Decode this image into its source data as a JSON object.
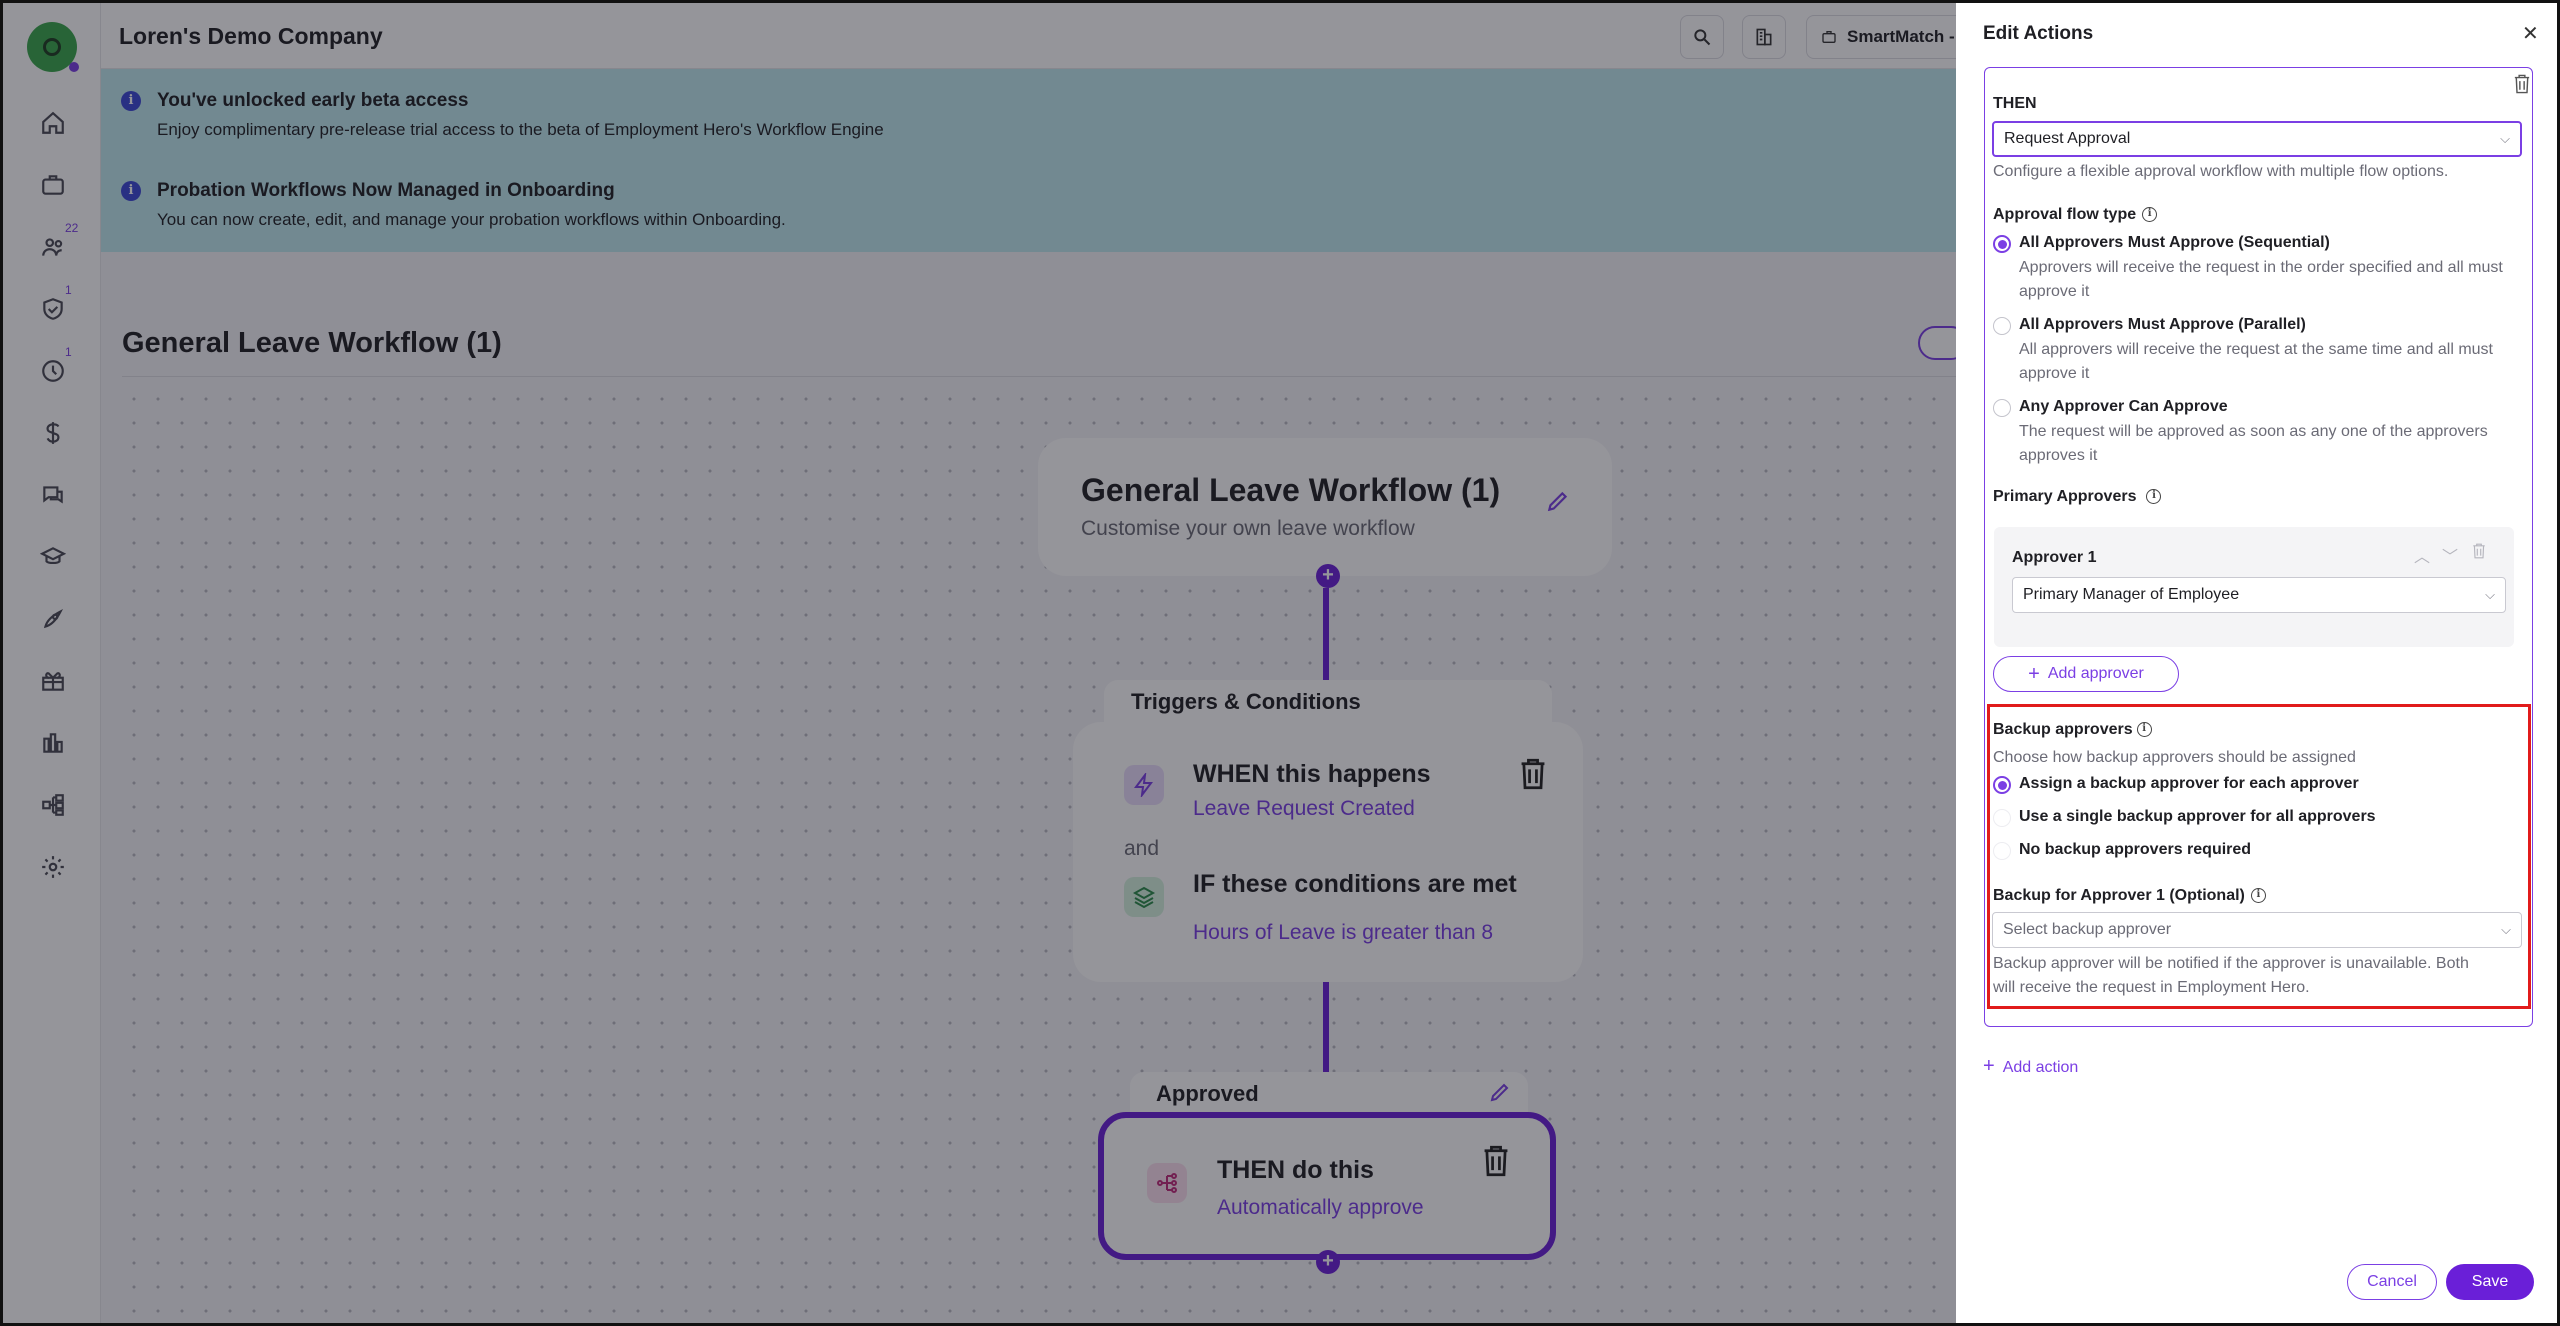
{
  "topbar": {
    "company_name": "Loren's Demo Company",
    "smartmatch_label": "SmartMatch -"
  },
  "sidebar": {
    "items": [
      {
        "icon": "home-icon"
      },
      {
        "icon": "briefcase-icon"
      },
      {
        "icon": "people-icon",
        "badge": "22"
      },
      {
        "icon": "shield-check-icon",
        "badge": "1"
      },
      {
        "icon": "clock-icon",
        "badge": "1"
      },
      {
        "icon": "dollar-icon"
      },
      {
        "icon": "chat-icon"
      },
      {
        "icon": "graduation-icon"
      },
      {
        "icon": "rocket-icon"
      },
      {
        "icon": "gift-icon"
      },
      {
        "icon": "chart-icon"
      },
      {
        "icon": "workflow-icon"
      },
      {
        "icon": "gear-icon"
      }
    ]
  },
  "banners": [
    {
      "title": "You've unlocked early beta access",
      "text": "Enjoy complimentary pre-release trial access to the beta of Employment Hero's Workflow Engine"
    },
    {
      "title": "Probation Workflows Now Managed in Onboarding",
      "text": "You can now create, edit, and manage your probation workflows within Onboarding."
    }
  ],
  "workflow": {
    "page_title": "General Leave Workflow (1)",
    "header_card": {
      "title": "General Leave Workflow (1)",
      "subtitle": "Customise your own leave workflow"
    },
    "triggers_label": "Triggers & Conditions",
    "when_title": "WHEN this happens",
    "when_value": "Leave Request Created",
    "and_label": "and",
    "if_title": "IF these conditions are met",
    "if_value": "Hours of Leave is greater than 8",
    "approved_label": "Approved",
    "then_title": "THEN do this",
    "then_value": "Automatically approve"
  },
  "panel": {
    "title": "Edit Actions",
    "then_label": "THEN",
    "action_select": "Request Approval",
    "action_help": "Configure a flexible approval workflow with multiple flow options.",
    "flow_type_label": "Approval flow type",
    "flow_options": [
      {
        "title": "All Approvers Must Approve (Sequential)",
        "desc_1": "Approvers will receive the request in the order specified and all must",
        "desc_2": "approve it",
        "selected": true
      },
      {
        "title": "All Approvers Must Approve (Parallel)",
        "desc_1": "All approvers will receive the request at the same time and all must",
        "desc_2": "approve it",
        "selected": false
      },
      {
        "title": "Any Approver Can Approve",
        "desc_1": "The request will be approved as soon as any one of the approvers",
        "desc_2": "approves it",
        "selected": false
      }
    ],
    "primary_approvers_label": "Primary Approvers",
    "approver_1_label": "Approver 1",
    "approver_1_value": "Primary Manager of Employee",
    "add_approver_label": "Add approver",
    "backup_label": "Backup approvers",
    "backup_help": "Choose how backup approvers should be assigned",
    "backup_options": [
      {
        "title": "Assign a backup approver for each approver",
        "selected": true
      },
      {
        "title": "Use a single backup approver for all approvers",
        "selected": false
      },
      {
        "title": "No backup approvers required",
        "selected": false
      }
    ],
    "backup_for_label": "Backup for Approver 1 (Optional)",
    "backup_select_placeholder": "Select backup approver",
    "backup_note_1": "Backup approver will be notified if the approver is unavailable. Both",
    "backup_note_2": "will receive the request in Employment Hero.",
    "add_action_label": "Add action",
    "cancel_label": "Cancel",
    "save_label": "Save"
  },
  "colors": {
    "accent": "#7b3fe4",
    "banner": "#bfe9ef",
    "highlight": "#e11b1b"
  }
}
